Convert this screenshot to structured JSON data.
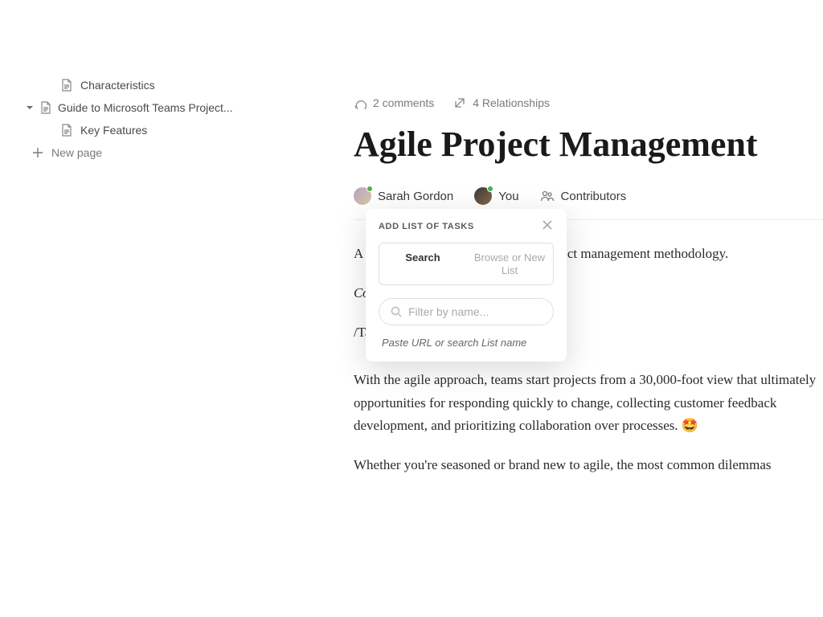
{
  "sidebar": {
    "items": [
      {
        "label": "Characteristics",
        "indent": "child"
      },
      {
        "label": "Guide to Microsoft Teams Project...",
        "indent": "parent",
        "expandable": true
      },
      {
        "label": "Key Features",
        "indent": "child"
      }
    ],
    "new_page_label": "New page"
  },
  "meta": {
    "comments": "2 comments",
    "relationships": "4 Relationships"
  },
  "title": "Agile Project Management",
  "contributors": [
    {
      "name": "Sarah Gordon",
      "online": true,
      "avatar_class": "a1"
    },
    {
      "name": "You",
      "online": true,
      "avatar_class": "a2"
    }
  ],
  "contributors_label": "Contributors",
  "content": {
    "line1_prefix": "A",
    "line1_suffix": "ect management methodology.",
    "line2": "Confident. Ambitious. Impressive.",
    "tableline": "/Table of Tasks (List view)",
    "para1": "With the agile approach, teams start projects from a 30,000-foot view that ultimately opportunities for responding quickly to change, collecting customer feedback development, and prioritizing collaboration over processes. 🤩",
    "para2": "Whether you're seasoned or brand new to agile, the most common dilemmas"
  },
  "popover": {
    "title": "ADD LIST OF TASKS",
    "tabs": {
      "search": "Search",
      "browse": "Browse or New List"
    },
    "filter_placeholder": "Filter by name...",
    "hint": "Paste URL or search List name"
  }
}
